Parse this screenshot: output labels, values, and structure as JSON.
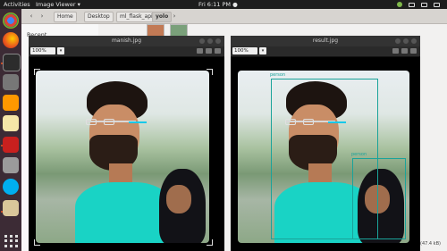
{
  "topbar": {
    "activities": "Activities",
    "app_menu": "Image Viewer ▾",
    "clock": "Fri 6:11 PM ●"
  },
  "files": {
    "breadcrumbs": [
      "Home",
      "Desktop",
      "ml_flask_api",
      "yolo"
    ],
    "sidebar_recent": "Recent"
  },
  "viewers": [
    {
      "title": "manish.jpg",
      "zoom": "100%"
    },
    {
      "title": "result.jpg",
      "zoom": "100%"
    }
  ],
  "detections": {
    "label_1": "person",
    "label_2": "person"
  },
  "status": {
    "size_text": "(47.4 kB)"
  },
  "colors": {
    "box": "#1aa39a",
    "dock": "#3c2b35",
    "shirt": "#19d3c5"
  },
  "dock_icons": [
    "chrome-icon",
    "firefox-icon",
    "terminal-icon",
    "camera-icon",
    "sublime-icon",
    "text-editor-icon",
    "filezilla-icon",
    "files-icon",
    "skype-icon",
    "installer-icon",
    "app-grid-icon"
  ]
}
